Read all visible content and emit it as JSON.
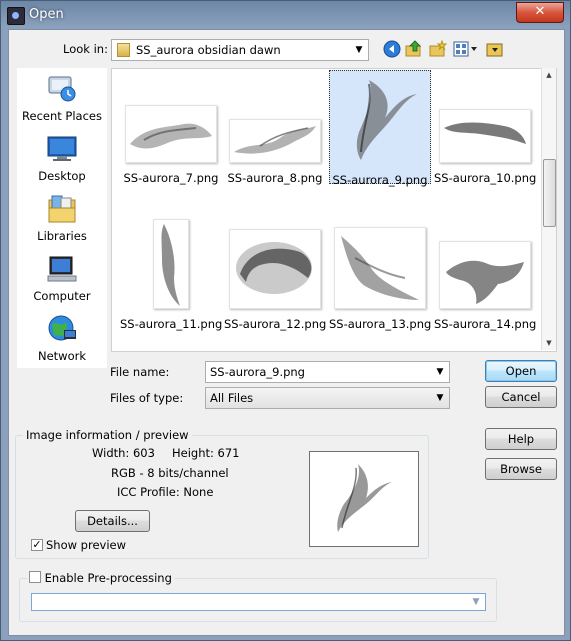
{
  "window": {
    "title": "Open",
    "close_label": "✕"
  },
  "toolbar": {
    "look_in_label": "Look in:",
    "current_folder": "SS_aurora obsidian dawn",
    "icons": [
      "back-icon",
      "up-folder-icon",
      "new-folder-icon",
      "view-menu-icon",
      "favorites-folder-icon"
    ]
  },
  "places": [
    {
      "label": "Recent Places",
      "icon": "recent-places-icon"
    },
    {
      "label": "Desktop",
      "icon": "desktop-icon"
    },
    {
      "label": "Libraries",
      "icon": "libraries-icon"
    },
    {
      "label": "Computer",
      "icon": "computer-icon"
    },
    {
      "label": "Network",
      "icon": "network-icon"
    }
  ],
  "files": [
    {
      "name": "SS-aurora_7.png",
      "selected": false
    },
    {
      "name": "SS-aurora_8.png",
      "selected": false
    },
    {
      "name": "SS-aurora_9.png",
      "selected": true
    },
    {
      "name": "SS-aurora_10.png",
      "selected": false
    },
    {
      "name": "SS-aurora_11.png",
      "selected": false
    },
    {
      "name": "SS-aurora_12.png",
      "selected": false
    },
    {
      "name": "SS-aurora_13.png",
      "selected": false
    },
    {
      "name": "SS-aurora_14.png",
      "selected": false
    }
  ],
  "form": {
    "file_name_label": "File name:",
    "file_name_value": "SS-aurora_9.png",
    "files_of_type_label": "Files of type:",
    "files_of_type_value": "All Files"
  },
  "buttons": {
    "open": "Open",
    "cancel": "Cancel",
    "help": "Help",
    "browse": "Browse",
    "details": "Details..."
  },
  "image_info": {
    "group_title": "Image information / preview",
    "width": "Width: 603",
    "height": "Height: 671",
    "color": "RGB - 8 bits/channel",
    "icc": "ICC Profile: None",
    "show_preview_label": "Show preview",
    "show_preview_checked": true
  },
  "preprocessing": {
    "enable_label": "Enable Pre-processing",
    "checked": false,
    "dropdown_value": ""
  }
}
